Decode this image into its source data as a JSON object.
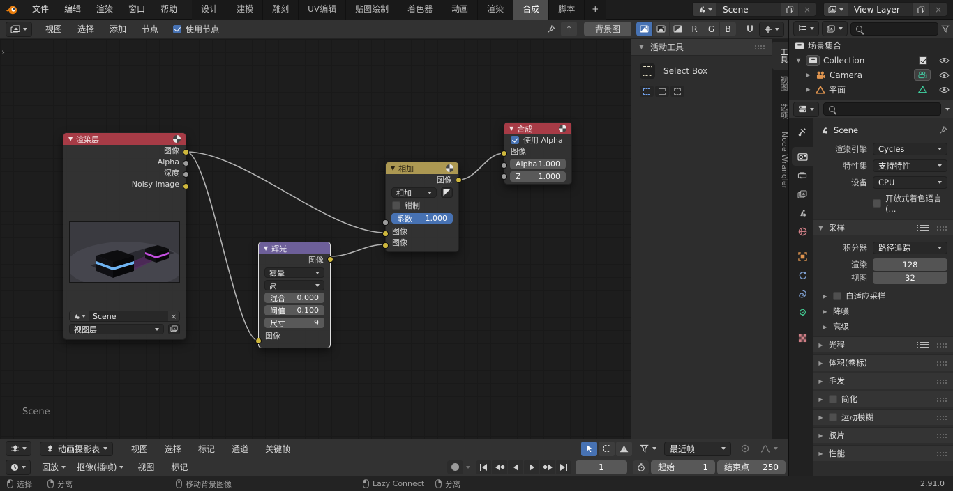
{
  "topbar": {
    "menus": [
      "文件",
      "编辑",
      "渲染",
      "窗口",
      "帮助"
    ],
    "workspaces": [
      "设计",
      "建模",
      "雕刻",
      "UV编辑",
      "贴图绘制",
      "着色器",
      "动画",
      "渲染",
      "合成",
      "脚本"
    ],
    "add_workspace": "+",
    "scene_selector": {
      "value": "Scene"
    },
    "view_layer_selector": {
      "value": "View Layer"
    }
  },
  "node_editor": {
    "header": {
      "menus": [
        "视图",
        "选择",
        "添加",
        "节点"
      ],
      "use_nodes": {
        "label": "使用节点",
        "checked": true
      },
      "backdrop_button": "背景图",
      "channel_toggles": [
        "R",
        "G",
        "B"
      ]
    },
    "canvas": {
      "scene_watermark": "Scene"
    },
    "tool_panel": {
      "title": "活动工具",
      "tool_name": "Select Box"
    },
    "sidebar_tabs": {
      "tool": "工具",
      "view": "视图",
      "options": "选项",
      "node_wrangler": "Node Wrangler"
    },
    "nodes": {
      "render_layers": {
        "title": "渲染层",
        "outputs": [
          "图像",
          "Alpha",
          "深度",
          "Noisy Image"
        ],
        "scene": "Scene",
        "view_layer": "视图层"
      },
      "glare": {
        "title": "辉光",
        "output": "图像",
        "input": "图像",
        "glare_type": "雾晕",
        "quality": "高",
        "mix": {
          "label": "混合",
          "value": "0.000"
        },
        "threshold": {
          "label": "阈值",
          "value": "0.100"
        },
        "size": {
          "label": "尺寸",
          "value": "9"
        }
      },
      "mix": {
        "title": "相加",
        "output": "图像",
        "blend_mode": "相加",
        "clamp": {
          "label": "钳制",
          "checked": false
        },
        "factor": {
          "label": "系数",
          "value": "1.000"
        },
        "inputs": [
          "图像",
          "图像"
        ]
      },
      "composite": {
        "title": "合成",
        "use_alpha": {
          "label": "使用 Alpha",
          "checked": true
        },
        "input": "图像",
        "alpha": {
          "label": "Alpha",
          "value": "1.000"
        },
        "z": {
          "label": "Z",
          "value": "1.000"
        }
      }
    }
  },
  "outliner": {
    "root": "场景集合",
    "items": [
      {
        "label": "Collection"
      },
      {
        "label": "Camera"
      },
      {
        "label": "平面"
      }
    ]
  },
  "properties": {
    "pinned_id": "Scene",
    "engine": {
      "label": "渲染引擎",
      "value": "Cycles"
    },
    "feature_set": {
      "label": "特性集",
      "value": "支持特性"
    },
    "device": {
      "label": "设备",
      "value": "CPU"
    },
    "osl": {
      "label": "开放式着色语言 (..."
    },
    "sampling": {
      "title": "采样",
      "integrator": {
        "label": "积分器",
        "value": "路径追踪"
      },
      "render": {
        "label": "渲染",
        "value": "128"
      },
      "viewport": {
        "label": "视图",
        "value": "32"
      },
      "adaptive": "自适应采样",
      "denoise": "降噪",
      "advanced": "高级"
    },
    "panels": [
      "光程",
      "体积(卷标)",
      "毛发",
      "简化",
      "运动模糊",
      "胶片",
      "性能"
    ]
  },
  "dope_sheet": {
    "mode": "动画摄影表",
    "menus": [
      "视图",
      "选择",
      "标记",
      "通道",
      "关键帧"
    ],
    "snap": "最近帧"
  },
  "timeline": {
    "playback": "回放",
    "keying": "抠像(插帧)",
    "menus": [
      "视图",
      "标记"
    ],
    "current_frame": "1",
    "start": {
      "label": "起始",
      "value": "1"
    },
    "end": {
      "label": "结束点",
      "value": "250"
    }
  },
  "status_bar": {
    "hints": [
      {
        "label": "选择"
      },
      {
        "label": "分离"
      },
      {
        "label": "移动背景图像"
      },
      {
        "label": "Lazy Connect"
      },
      {
        "label": "分离"
      }
    ],
    "version": "2.91.0"
  },
  "colors": {
    "accent_blue": "#4772b3",
    "node_red": "#a73b46",
    "node_purple": "#6d5f99",
    "node_yellow": "#ac9852",
    "socket_yellow": "#cfb83d",
    "socket_gray": "#9d9d9d"
  }
}
